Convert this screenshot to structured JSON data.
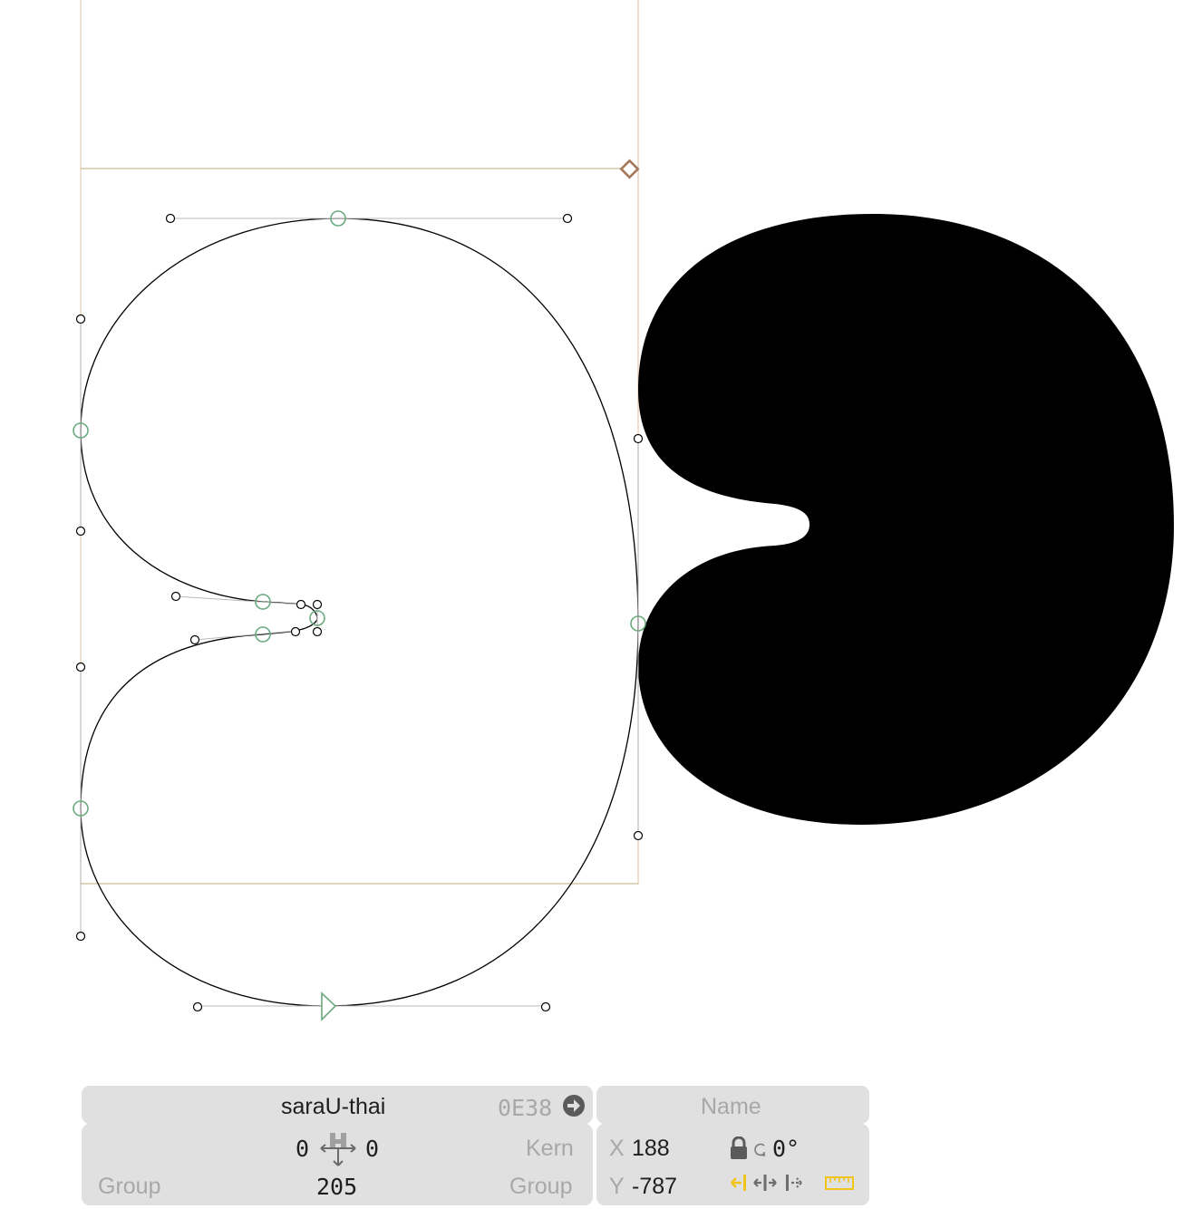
{
  "glyph": {
    "name": "saraU-thai",
    "unicode": "0E38",
    "name_placeholder": "Name"
  },
  "metrics": {
    "lsb": "0",
    "rsb": "0",
    "width": "205",
    "left_group_placeholder": "Group",
    "right_group_placeholder": "Group",
    "kern_placeholder": "Kern"
  },
  "selection": {
    "x_label": "X",
    "x_value": "188",
    "y_label": "Y",
    "y_value": "-787",
    "rotation": "0°"
  },
  "colors": {
    "node_green": "#6aaa7e",
    "metric_line": "#c8bf94",
    "anchor_brown": "#a5765a",
    "accent_yellow": "#f0c419",
    "panel_bg": "#e0e0e0"
  },
  "icons": {
    "goto": "circle-arrow-right-icon",
    "metrics_link": "sidebearing-link-icon",
    "lock": "lock-icon",
    "rotate": "rotate-icon",
    "align_left": "align-left-icon",
    "align_center": "align-center-icon",
    "align_right": "align-right-icon",
    "ruler": "ruler-icon"
  }
}
